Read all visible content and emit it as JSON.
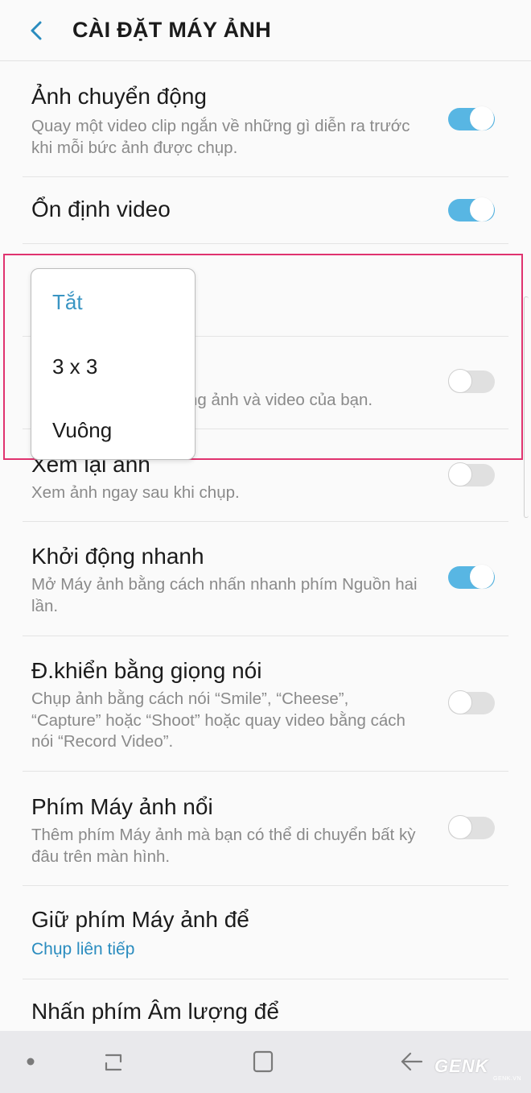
{
  "header": {
    "title": "CÀI ĐẶT MÁY ẢNH",
    "back_icon": "chevron-left-icon"
  },
  "settings": [
    {
      "title": "Ảnh chuyển động",
      "description": "Quay một video clip ngắn về những gì diễn ra trước khi mỗi bức ảnh được chụp.",
      "toggle": true
    },
    {
      "title": "Ổn định video",
      "toggle": true
    },
    {
      "title": "",
      "partial_description": "ng ảnh và video của bạn.",
      "toggle": false
    },
    {
      "title": "Xem lại ảnh",
      "description": "Xem ảnh ngay sau khi chụp.",
      "toggle": false
    },
    {
      "title": "Khởi động nhanh",
      "description": "Mở Máy ảnh bằng cách nhấn nhanh phím Nguồn hai lần.",
      "toggle": true
    },
    {
      "title": "Đ.khiển bằng giọng nói",
      "description": "Chụp ảnh bằng cách nói “Smile”, “Cheese”, “Capture” hoặc “Shoot” hoặc quay video bằng cách nói “Record Video”.",
      "toggle": false
    },
    {
      "title": "Phím Máy ảnh nổi",
      "description": "Thêm phím Máy ảnh mà bạn có thể di chuyển bất kỳ đâu trên màn hình.",
      "toggle": false
    },
    {
      "title": "Giữ phím Máy ảnh để",
      "value": "Chụp liên tiếp"
    },
    {
      "title": "Nhấn phím Âm lượng để"
    }
  ],
  "dropdown": {
    "options": [
      "Tắt",
      "3 x 3",
      "Vuông"
    ],
    "selected_index": 0
  },
  "navbar": {
    "items": [
      "dot-icon",
      "recent-apps-icon",
      "home-icon",
      "back-arrow-icon"
    ]
  },
  "watermark": {
    "text": "GENK",
    "subtext": "GENK.VN"
  },
  "colors": {
    "accent": "#2a8cbf",
    "toggle_on": "#58b6e3",
    "highlight": "#e0336f"
  }
}
